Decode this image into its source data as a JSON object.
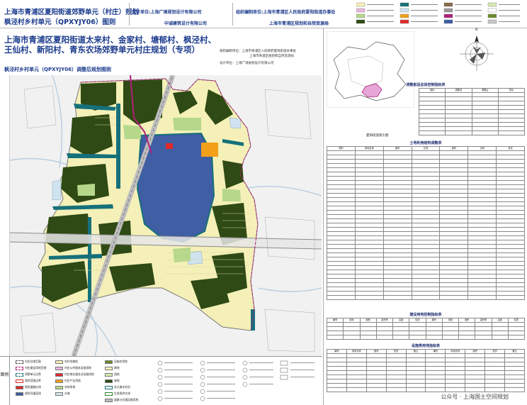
{
  "header": {
    "title_line1": "上海市青浦区夏阳街道郊野单元（村庄）规划",
    "title_line2": "枫泾村乡村单元（QPXYJY06）图则",
    "design_label": "设计单位:上海广境规划设计有限公司",
    "design_label2": "中诚建筑设计有限公司",
    "org_label": "组织编制单位:上海市青浦区人民政府夏阳街道办事处",
    "org_label2": "上海市青浦区规划和自然资源局"
  },
  "map": {
    "title": "上海市青浦区夏阳街道太来村、金家村、塘郁村、枫泾村、王仙村、新阳村、青东农场郊野单元村庄规划（专项）",
    "subtitle": "枫泾村乡村单元（QPXYJY06）调整后规划图则",
    "info_1": "组织编制单位：上海市青浦区人民政府夏阳街道办事处",
    "info_2": "上海市青浦区规划和自然资源局",
    "info_3": "设计单位：上海广境规划设计有限公司"
  },
  "colors": {
    "dark_green": "#2f4a14",
    "cream": "#f4f0b8",
    "light_green": "#b6d88a",
    "teal": "#16707a",
    "lake_blue": "#3f5ea4",
    "water_blue": "#cfe3f0",
    "magenta": "#b0207a",
    "orange": "#f2a019",
    "red": "#e02a2a"
  },
  "legend": {
    "side_label": "图例",
    "items": [
      "村庄驻地范围",
      "村庄建设用地范围",
      "郊野单元边界",
      "规划范围边界",
      "规划道路红线",
      "规划河道蓝线",
      "农村宅基地",
      "村庄公共服务设施用地",
      "村庄商业服务业设施用地",
      "村庄产业用地",
      "农林用地",
      "水域",
      "设施农用地",
      "耕地",
      "园地",
      "林地",
      "永久基本农田",
      "生态保护红线",
      "道路与交通设施用地"
    ]
  },
  "right": {
    "location_caption": "夏阳街道索引图",
    "control_title": "调整前后总体控制指标表",
    "land_title": "土地利用结构调整表",
    "ctrl_title": "建设用地控制指标表",
    "fac_title": "设施类用地指标表",
    "watermark": "公众号 · 上海国土空间规划"
  }
}
